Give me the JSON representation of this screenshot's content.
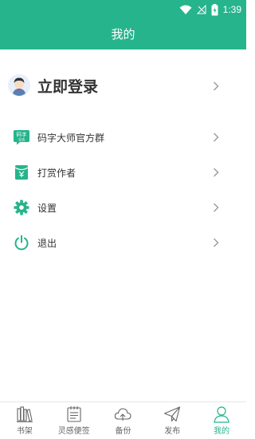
{
  "status_bar": {
    "time": "1:39"
  },
  "header": {
    "title": "我的"
  },
  "login": {
    "label": "立即登录"
  },
  "menu": [
    {
      "label": "码字大师官方群",
      "icon": "qq-group-icon",
      "icon_text_top": "码字",
      "icon_text_bottom": "交流"
    },
    {
      "label": "打赏作者",
      "icon": "red-envelope-icon"
    },
    {
      "label": "设置",
      "icon": "gear-icon"
    },
    {
      "label": "退出",
      "icon": "power-icon"
    }
  ],
  "tabs": [
    {
      "label": "书架",
      "icon": "bookshelf-icon"
    },
    {
      "label": "灵感便签",
      "icon": "notepad-icon"
    },
    {
      "label": "备份",
      "icon": "cloud-icon"
    },
    {
      "label": "发布",
      "icon": "paper-plane-icon"
    },
    {
      "label": "我的",
      "icon": "person-icon",
      "active": true
    }
  ],
  "colors": {
    "accent": "#26b48c",
    "text": "#333333",
    "tab_inactive": "#666666"
  }
}
